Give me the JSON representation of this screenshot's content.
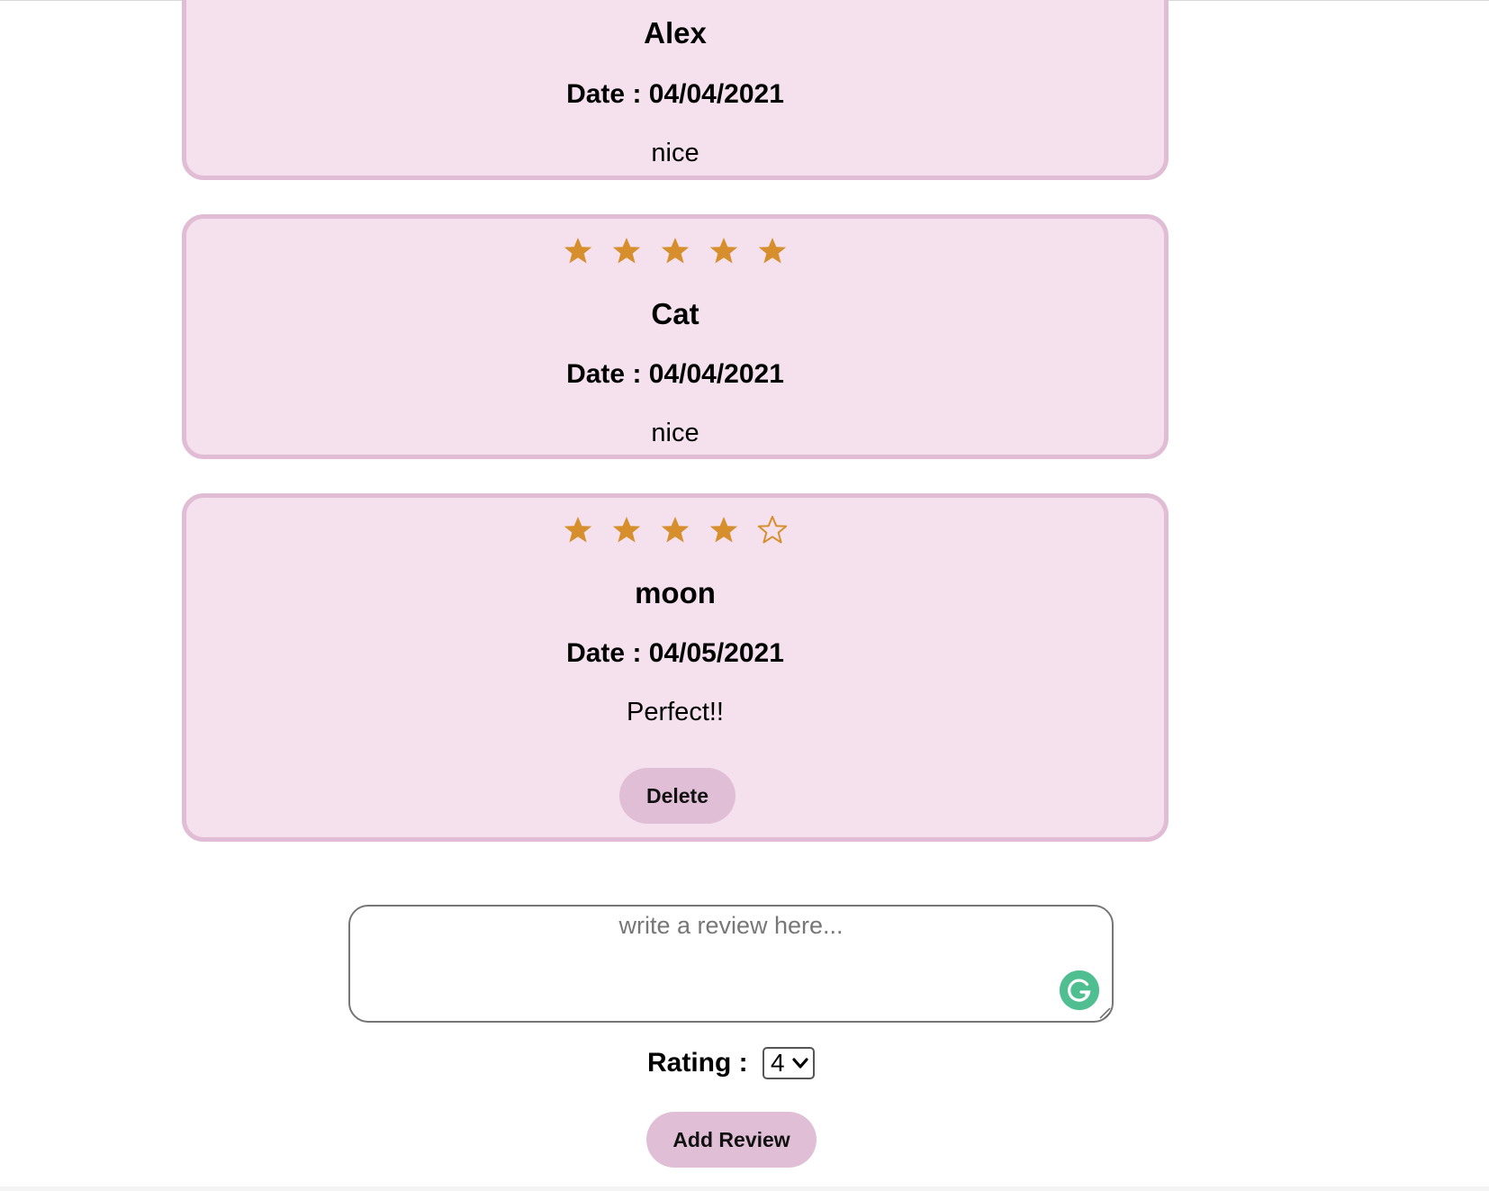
{
  "reviews": [
    {
      "name": "Alex",
      "date": "Date : 04/04/2021",
      "comment": "nice",
      "rating": null,
      "can_delete": false
    },
    {
      "name": "Cat",
      "date": "Date : 04/04/2021",
      "comment": "nice",
      "rating": 5,
      "can_delete": false
    },
    {
      "name": "moon",
      "date": "Date : 04/05/2021",
      "comment": "Perfect!!",
      "rating": 4,
      "can_delete": true,
      "delete_label": "Delete"
    }
  ],
  "form": {
    "review_placeholder": "write a review here...",
    "rating_label": "Rating :",
    "rating_value": "4",
    "add_label": "Add Review"
  },
  "colors": {
    "card_bg": "#f5e1ee",
    "card_border": "#e0bdd5",
    "star": "#d68f2c",
    "button_bg": "#e0bfd6",
    "grammarly": "#4fbf92"
  },
  "icons": {
    "star_filled": "star-filled-icon",
    "star_empty": "star-empty-icon",
    "grammarly": "grammarly-icon",
    "dropdown": "chevron-down-icon"
  }
}
